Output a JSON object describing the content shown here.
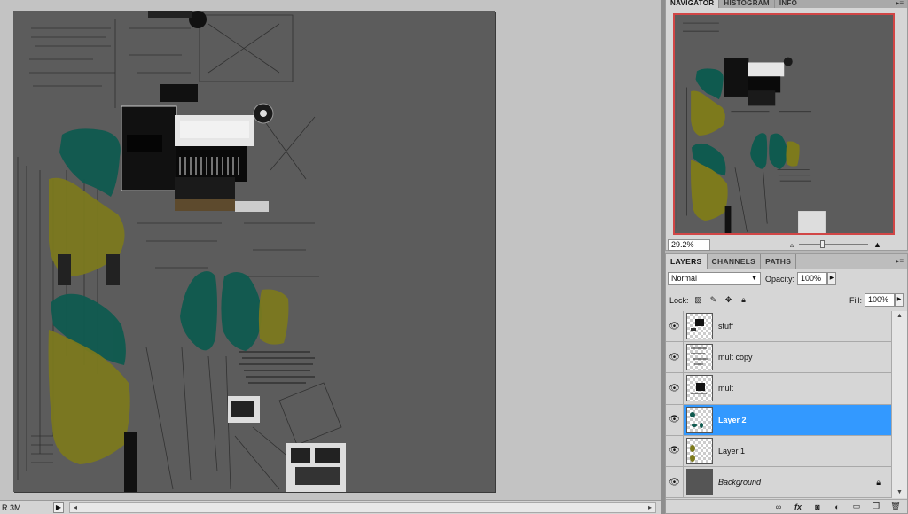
{
  "status": {
    "doc_size": "R.3M"
  },
  "navigator": {
    "tabs": [
      "NAVIGATOR",
      "HISTOGRAM",
      "INFO"
    ],
    "zoom": "29.2%"
  },
  "layers_panel": {
    "tabs": [
      "LAYERS",
      "CHANNELS",
      "PATHS"
    ],
    "blend_mode": "Normal",
    "opacity_label": "Opacity:",
    "opacity_value": "100%",
    "lock_label": "Lock:",
    "fill_label": "Fill:",
    "fill_value": "100%",
    "layers": [
      {
        "name": "stuff",
        "selected": false
      },
      {
        "name": "mult copy",
        "selected": false
      },
      {
        "name": "mult",
        "selected": false
      },
      {
        "name": "Layer 2",
        "selected": true
      },
      {
        "name": "Layer 1",
        "selected": false
      },
      {
        "name": "Background",
        "selected": false
      }
    ]
  },
  "colors": {
    "accent": "#3399ff",
    "canvas": "#5c5c5c",
    "teal": "#0f5a4f",
    "olive": "#7d7a1c",
    "nav_frame": "#d14646"
  },
  "icons": {
    "visibility": "eye-icon",
    "lock": "padlock-icon",
    "footer": [
      "link-icon",
      "fx-icon",
      "mask-icon",
      "adjustment-icon",
      "folder-icon",
      "new-layer-icon",
      "trash-icon"
    ]
  }
}
